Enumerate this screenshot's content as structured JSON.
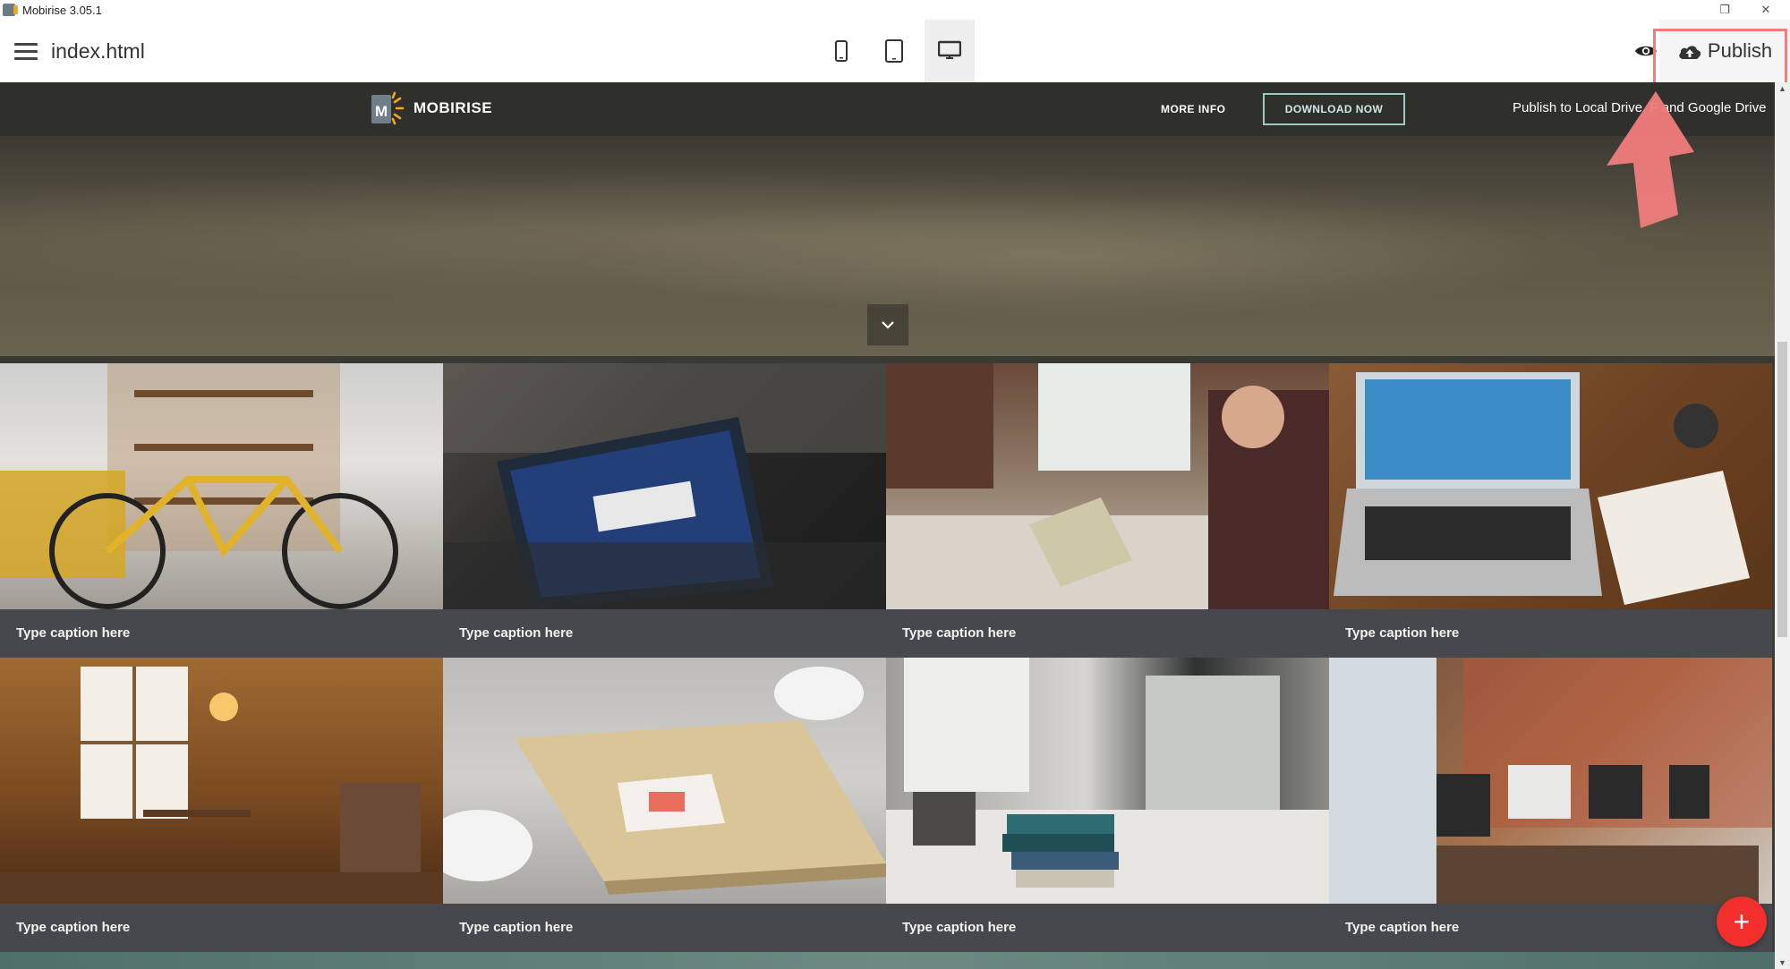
{
  "window": {
    "title": "Mobirise 3.05.1",
    "restore_glyph": "❐",
    "close_glyph": "✕"
  },
  "toolbar": {
    "file_name": "index.html",
    "devices": [
      "mobile-icon",
      "tablet-icon",
      "desktop-icon"
    ],
    "active_device": "desktop",
    "publish_label": "Publish",
    "highlight_color": "#f07c7c"
  },
  "site": {
    "brand_name": "MOBIRISE",
    "nav_more": "MORE INFO",
    "nav_download": "DOWNLOAD NOW",
    "publish_hint": "Publish to Local Drive, F      and Google Drive"
  },
  "gallery": {
    "captions": [
      "Type caption here",
      "Type caption here",
      "Type caption here",
      "Type caption here",
      "Type caption here",
      "Type caption here",
      "Type caption here",
      "Type caption here"
    ]
  },
  "fab": {
    "label": "+"
  },
  "colors": {
    "fab": "#f1302d",
    "nav_bg": "#2f2f2b",
    "download_border": "#9cc9c3"
  }
}
